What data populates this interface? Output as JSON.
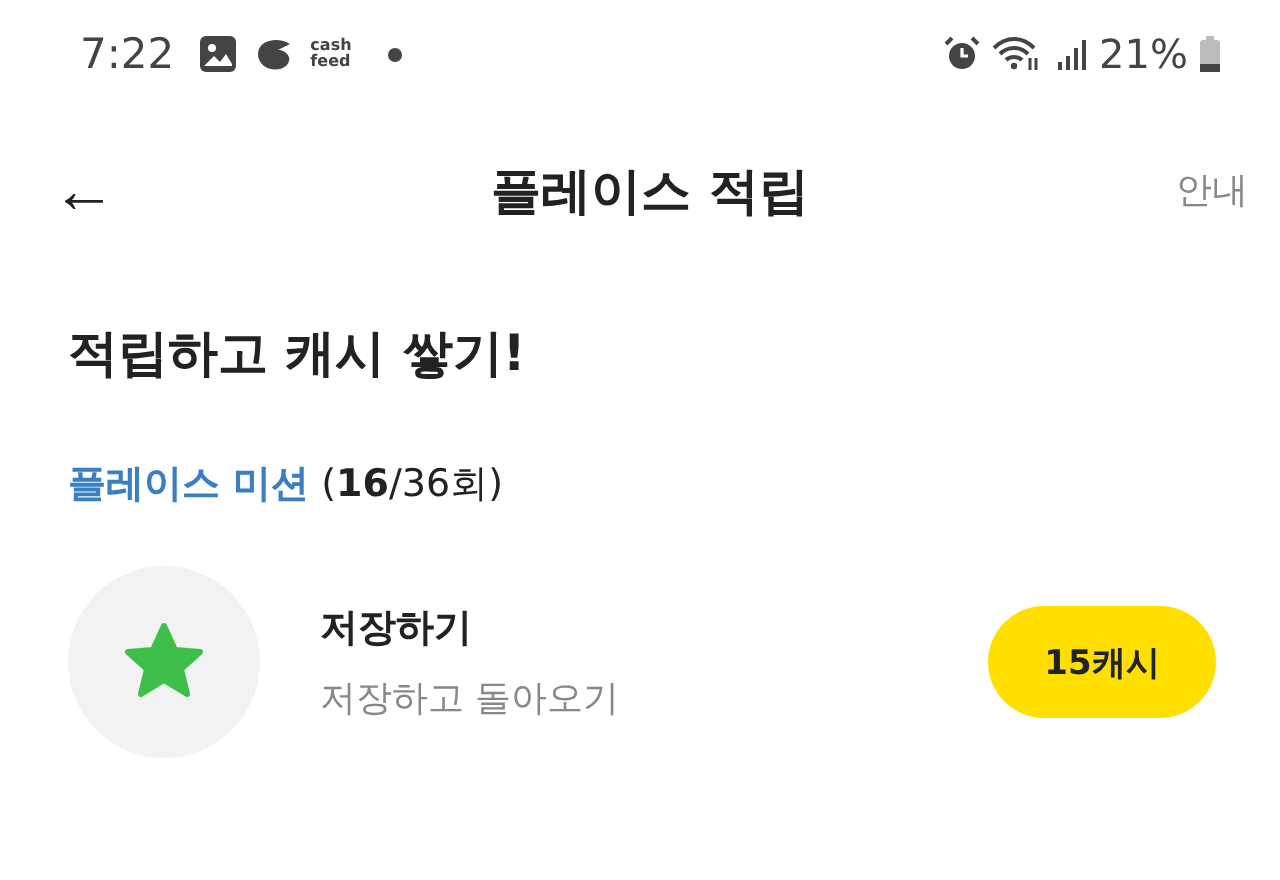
{
  "status_bar": {
    "time": "7:22",
    "app_logo_text": [
      "cash",
      "feed"
    ],
    "battery": "21%"
  },
  "header": {
    "back_icon": "←",
    "title": "플레이스 적립",
    "action": "안내"
  },
  "headline": "적립하고 캐시 쌓기!",
  "mission": {
    "title": "플레이스 미션",
    "count": "(**16**/36회)"
  },
  "tasks": [
    {
      "title": "저장하기",
      "subtitle": "저장하고 돌아오기",
      "reward": "15캐시"
    }
  ]
}
